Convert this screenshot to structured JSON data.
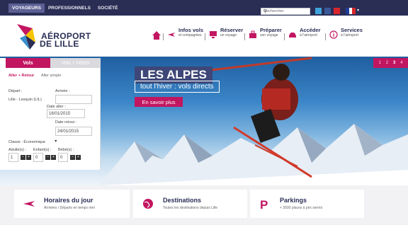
{
  "topbar": {
    "nav": [
      "VOYAGEURS",
      "PROFESSIONNELS",
      "SOCIÉTÉ"
    ],
    "search_placeholder": "Rechercher"
  },
  "logo": {
    "line1": "AÉROPORT",
    "line2": "DE LILLE"
  },
  "header_nav": [
    {
      "title": "Infos vols",
      "sub": "et compagnies"
    },
    {
      "title": "Réserver",
      "sub": "un voyage"
    },
    {
      "title": "Préparer",
      "sub": "son voyage"
    },
    {
      "title": "Accéder",
      "sub": "à l'aéroport"
    },
    {
      "title": "Services",
      "sub": "à l'aéroport"
    }
  ],
  "hero": {
    "title": "LES ALPES",
    "subtitle": "tout l'hiver : vols directs",
    "cta": "En savoir plus",
    "pager": [
      "1",
      "2",
      "3",
      "4"
    ],
    "current_slide": "3"
  },
  "booking": {
    "tab_flights": "Vols",
    "tab_flights_hotels": "Vols + hôtels",
    "trip_return": "Aller + Retour",
    "trip_oneway": "Aller simple",
    "depart_label": "Départ :",
    "depart_value": "Lille - Lesquin (LIL)",
    "arrivee_label": "Arrivée :",
    "date_aller_label": "Date aller :",
    "date_aller": "16/01/2015",
    "date_retour_label": "Date retour :",
    "date_retour": "24/01/2015",
    "classe_label": "Classe : Économique",
    "adultes_label": "Adulte(s) :",
    "enfants_label": "Enfant(s) :",
    "bebes_label": "Bébé(s) :",
    "adultes": "1",
    "enfants": "0",
    "bebes": "0"
  },
  "cards": [
    {
      "title": "Horaires du jour",
      "sub": "Arrivées / Départs en temps réel"
    },
    {
      "title": "Destinations",
      "sub": "Toutes les destinations depuis Lille"
    },
    {
      "title": "Parkings",
      "sub": "+ 3500 places à prix serrés"
    }
  ],
  "colors": {
    "navy": "#2a2e55",
    "magenta": "#c21661"
  }
}
